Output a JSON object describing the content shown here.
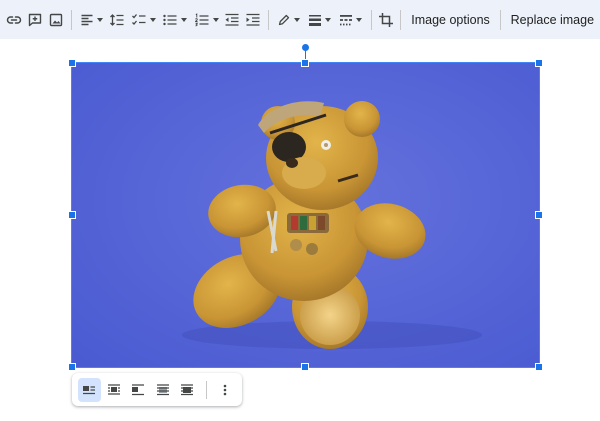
{
  "toolbar": {
    "icons": [
      "link-icon",
      "add-comment-icon",
      "insert-image-icon",
      "align-left-icon",
      "line-spacing-icon",
      "checklist-icon",
      "bulleted-list-icon",
      "numbered-list-icon",
      "decrease-indent-icon",
      "increase-indent-icon",
      "border-color-icon",
      "border-weight-icon",
      "border-dash-icon",
      "crop-icon"
    ],
    "image_options_label": "Image options",
    "replace_image_label": "Replace image"
  },
  "image": {
    "subject": "teddy-bear-photo",
    "background_color": "#5565d6",
    "selection_color": "#1a73e8"
  },
  "wrap_toolbar": {
    "icons": [
      "wrap-inline-icon",
      "wrap-text-icon",
      "break-text-icon",
      "behind-text-icon",
      "in-front-of-text-icon",
      "more-options-icon"
    ],
    "active": "wrap-inline-icon"
  }
}
